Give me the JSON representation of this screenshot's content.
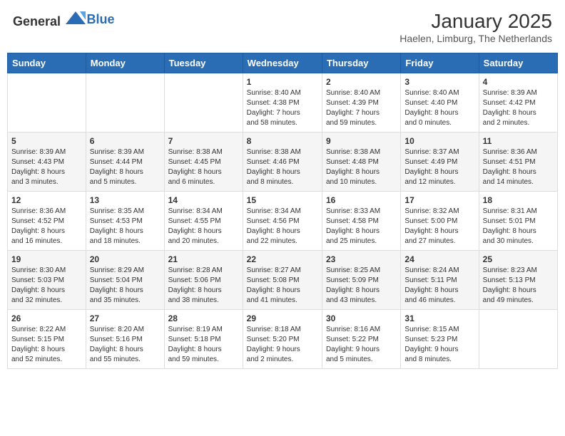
{
  "header": {
    "logo_general": "General",
    "logo_blue": "Blue",
    "month_year": "January 2025",
    "location": "Haelen, Limburg, The Netherlands"
  },
  "days_of_week": [
    "Sunday",
    "Monday",
    "Tuesday",
    "Wednesday",
    "Thursday",
    "Friday",
    "Saturday"
  ],
  "weeks": [
    [
      {
        "day": "",
        "info": ""
      },
      {
        "day": "",
        "info": ""
      },
      {
        "day": "",
        "info": ""
      },
      {
        "day": "1",
        "info": "Sunrise: 8:40 AM\nSunset: 4:38 PM\nDaylight: 7 hours\nand 58 minutes."
      },
      {
        "day": "2",
        "info": "Sunrise: 8:40 AM\nSunset: 4:39 PM\nDaylight: 7 hours\nand 59 minutes."
      },
      {
        "day": "3",
        "info": "Sunrise: 8:40 AM\nSunset: 4:40 PM\nDaylight: 8 hours\nand 0 minutes."
      },
      {
        "day": "4",
        "info": "Sunrise: 8:39 AM\nSunset: 4:42 PM\nDaylight: 8 hours\nand 2 minutes."
      }
    ],
    [
      {
        "day": "5",
        "info": "Sunrise: 8:39 AM\nSunset: 4:43 PM\nDaylight: 8 hours\nand 3 minutes."
      },
      {
        "day": "6",
        "info": "Sunrise: 8:39 AM\nSunset: 4:44 PM\nDaylight: 8 hours\nand 5 minutes."
      },
      {
        "day": "7",
        "info": "Sunrise: 8:38 AM\nSunset: 4:45 PM\nDaylight: 8 hours\nand 6 minutes."
      },
      {
        "day": "8",
        "info": "Sunrise: 8:38 AM\nSunset: 4:46 PM\nDaylight: 8 hours\nand 8 minutes."
      },
      {
        "day": "9",
        "info": "Sunrise: 8:38 AM\nSunset: 4:48 PM\nDaylight: 8 hours\nand 10 minutes."
      },
      {
        "day": "10",
        "info": "Sunrise: 8:37 AM\nSunset: 4:49 PM\nDaylight: 8 hours\nand 12 minutes."
      },
      {
        "day": "11",
        "info": "Sunrise: 8:36 AM\nSunset: 4:51 PM\nDaylight: 8 hours\nand 14 minutes."
      }
    ],
    [
      {
        "day": "12",
        "info": "Sunrise: 8:36 AM\nSunset: 4:52 PM\nDaylight: 8 hours\nand 16 minutes."
      },
      {
        "day": "13",
        "info": "Sunrise: 8:35 AM\nSunset: 4:53 PM\nDaylight: 8 hours\nand 18 minutes."
      },
      {
        "day": "14",
        "info": "Sunrise: 8:34 AM\nSunset: 4:55 PM\nDaylight: 8 hours\nand 20 minutes."
      },
      {
        "day": "15",
        "info": "Sunrise: 8:34 AM\nSunset: 4:56 PM\nDaylight: 8 hours\nand 22 minutes."
      },
      {
        "day": "16",
        "info": "Sunrise: 8:33 AM\nSunset: 4:58 PM\nDaylight: 8 hours\nand 25 minutes."
      },
      {
        "day": "17",
        "info": "Sunrise: 8:32 AM\nSunset: 5:00 PM\nDaylight: 8 hours\nand 27 minutes."
      },
      {
        "day": "18",
        "info": "Sunrise: 8:31 AM\nSunset: 5:01 PM\nDaylight: 8 hours\nand 30 minutes."
      }
    ],
    [
      {
        "day": "19",
        "info": "Sunrise: 8:30 AM\nSunset: 5:03 PM\nDaylight: 8 hours\nand 32 minutes."
      },
      {
        "day": "20",
        "info": "Sunrise: 8:29 AM\nSunset: 5:04 PM\nDaylight: 8 hours\nand 35 minutes."
      },
      {
        "day": "21",
        "info": "Sunrise: 8:28 AM\nSunset: 5:06 PM\nDaylight: 8 hours\nand 38 minutes."
      },
      {
        "day": "22",
        "info": "Sunrise: 8:27 AM\nSunset: 5:08 PM\nDaylight: 8 hours\nand 41 minutes."
      },
      {
        "day": "23",
        "info": "Sunrise: 8:25 AM\nSunset: 5:09 PM\nDaylight: 8 hours\nand 43 minutes."
      },
      {
        "day": "24",
        "info": "Sunrise: 8:24 AM\nSunset: 5:11 PM\nDaylight: 8 hours\nand 46 minutes."
      },
      {
        "day": "25",
        "info": "Sunrise: 8:23 AM\nSunset: 5:13 PM\nDaylight: 8 hours\nand 49 minutes."
      }
    ],
    [
      {
        "day": "26",
        "info": "Sunrise: 8:22 AM\nSunset: 5:15 PM\nDaylight: 8 hours\nand 52 minutes."
      },
      {
        "day": "27",
        "info": "Sunrise: 8:20 AM\nSunset: 5:16 PM\nDaylight: 8 hours\nand 55 minutes."
      },
      {
        "day": "28",
        "info": "Sunrise: 8:19 AM\nSunset: 5:18 PM\nDaylight: 8 hours\nand 59 minutes."
      },
      {
        "day": "29",
        "info": "Sunrise: 8:18 AM\nSunset: 5:20 PM\nDaylight: 9 hours\nand 2 minutes."
      },
      {
        "day": "30",
        "info": "Sunrise: 8:16 AM\nSunset: 5:22 PM\nDaylight: 9 hours\nand 5 minutes."
      },
      {
        "day": "31",
        "info": "Sunrise: 8:15 AM\nSunset: 5:23 PM\nDaylight: 9 hours\nand 8 minutes."
      },
      {
        "day": "",
        "info": ""
      }
    ]
  ]
}
